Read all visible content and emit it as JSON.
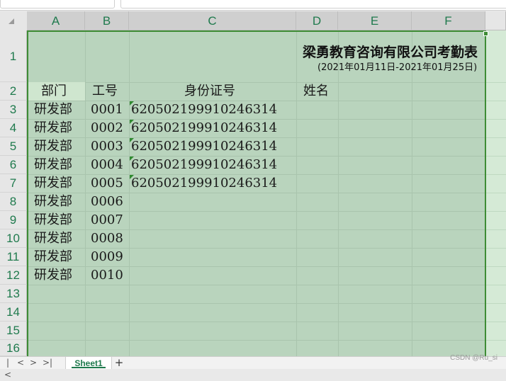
{
  "columns": [
    "A",
    "B",
    "C",
    "D",
    "E",
    "F"
  ],
  "rows": [
    "1",
    "2",
    "3",
    "4",
    "5",
    "6",
    "7",
    "8",
    "9",
    "10",
    "11",
    "12",
    "13",
    "14",
    "15",
    "16"
  ],
  "title": "梁勇教育咨询有限公司考勤表",
  "subtitle": "(2021年01月11日-2021年01月25日)",
  "headers": {
    "dept": "部门",
    "id": "工号",
    "idcard": "身份证号",
    "name": "姓名"
  },
  "records": [
    {
      "dept": "研发部",
      "id": "0001",
      "idcard": "620502199910246314"
    },
    {
      "dept": "研发部",
      "id": "0002",
      "idcard": "620502199910246314"
    },
    {
      "dept": "研发部",
      "id": "0003",
      "idcard": "620502199910246314"
    },
    {
      "dept": "研发部",
      "id": "0004",
      "idcard": "620502199910246314"
    },
    {
      "dept": "研发部",
      "id": "0005",
      "idcard": "620502199910246314"
    },
    {
      "dept": "研发部",
      "id": "0006",
      "idcard": ""
    },
    {
      "dept": "研发部",
      "id": "0007",
      "idcard": ""
    },
    {
      "dept": "研发部",
      "id": "0008",
      "idcard": ""
    },
    {
      "dept": "研发部",
      "id": "0009",
      "idcard": ""
    },
    {
      "dept": "研发部",
      "id": "0010",
      "idcard": ""
    }
  ],
  "sheet_tab": "Sheet1",
  "add_sheet": "+",
  "nav": [
    "|<",
    "<",
    ">",
    ">|"
  ],
  "watermark": "CSDN @Ru_si",
  "colors": {
    "selection": "#3e8c35",
    "grid_fill": "#b9d4bd",
    "header_text": "#1f7a4d"
  }
}
